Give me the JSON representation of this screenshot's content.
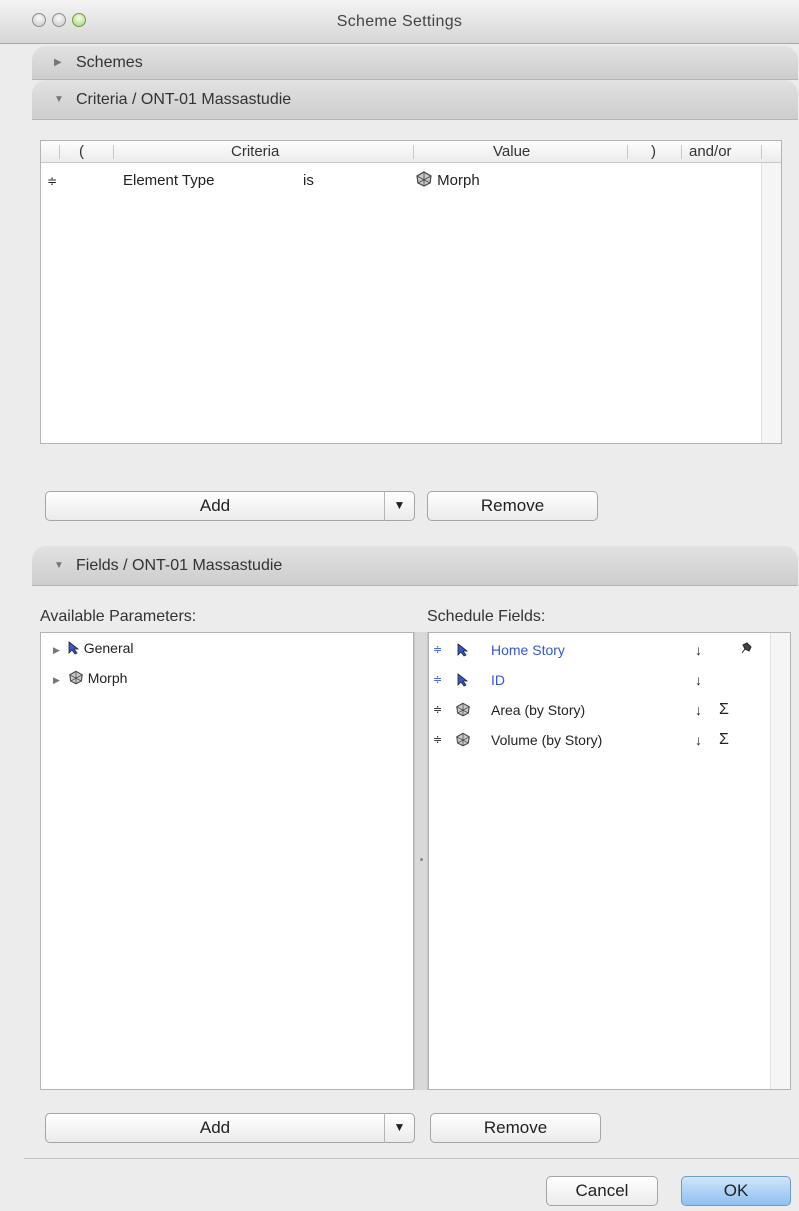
{
  "window": {
    "title": "Scheme Settings"
  },
  "sections": {
    "schemes": {
      "label": "Schemes",
      "expanded": false
    },
    "criteria": {
      "label": "Criteria / ONT-01 Massastudie",
      "expanded": true
    },
    "fields": {
      "label": "Fields / ONT-01 Massastudie",
      "expanded": true
    }
  },
  "criteria_table": {
    "columns": [
      "(",
      "Criteria",
      "Value",
      ")",
      "and/or"
    ],
    "rows": [
      {
        "handle": "≑",
        "criteria": "Element Type",
        "operator": "is",
        "value": "Morph"
      }
    ]
  },
  "criteria_buttons": {
    "add": "Add",
    "remove": "Remove"
  },
  "available_parameters": {
    "label": "Available Parameters:",
    "items": [
      {
        "label": "General",
        "icon": "cursor-arrow-icon"
      },
      {
        "label": "Morph",
        "icon": "morph-icon"
      }
    ]
  },
  "schedule_fields": {
    "label": "Schedule Fields:",
    "items": [
      {
        "label": "Home Story",
        "icon": "cursor-arrow-icon",
        "highlighted": true,
        "sort": "↓",
        "extra": "pin"
      },
      {
        "label": "ID",
        "icon": "cursor-arrow-icon",
        "highlighted": true,
        "sort": "↓",
        "extra": ""
      },
      {
        "label": "Area (by Story)",
        "icon": "morph-icon",
        "highlighted": false,
        "sort": "↓",
        "extra": "Σ"
      },
      {
        "label": "Volume (by Story)",
        "icon": "morph-icon",
        "highlighted": false,
        "sort": "↓",
        "extra": "Σ"
      }
    ]
  },
  "fields_buttons": {
    "add": "Add",
    "remove": "Remove"
  },
  "dialog_buttons": {
    "cancel": "Cancel",
    "ok": "OK"
  },
  "colors": {
    "accent_blue": "#3557d6",
    "ok_button": "#8fc0f0"
  }
}
